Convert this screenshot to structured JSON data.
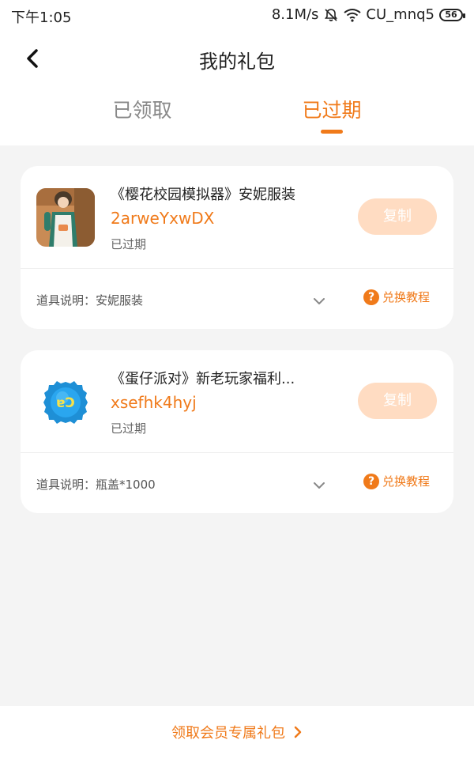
{
  "status_bar": {
    "time": "下午1:05",
    "speed": "8.1M/s",
    "carrier": "CU_mnq5",
    "battery": "56"
  },
  "nav": {
    "title": "我的礼包"
  },
  "tabs": [
    {
      "label": "已领取",
      "active": false
    },
    {
      "label": "已过期",
      "active": true
    }
  ],
  "colors": {
    "accent": "#f07a1a",
    "copy_button_disabled": "#ffdcc2",
    "background": "#f4f4f4"
  },
  "gifts": [
    {
      "title": "《樱花校园模拟器》安妮服装",
      "code": "2arweYxwDX",
      "status": "已过期",
      "copy_label": "复制",
      "description": "道具说明：安妮服装",
      "tutorial_label": "兑换教程",
      "icon": "anime-girl-costume-thumbnail"
    },
    {
      "title": "《蛋仔派对》新老玩家福利...",
      "code": "xsefhk4hyj",
      "status": "已过期",
      "copy_label": "复制",
      "description": "道具说明：瓶盖*1000",
      "tutorial_label": "兑换教程",
      "icon": "bottle-cap-icon"
    }
  ],
  "footer": {
    "member_link": "领取会员专属礼包"
  }
}
